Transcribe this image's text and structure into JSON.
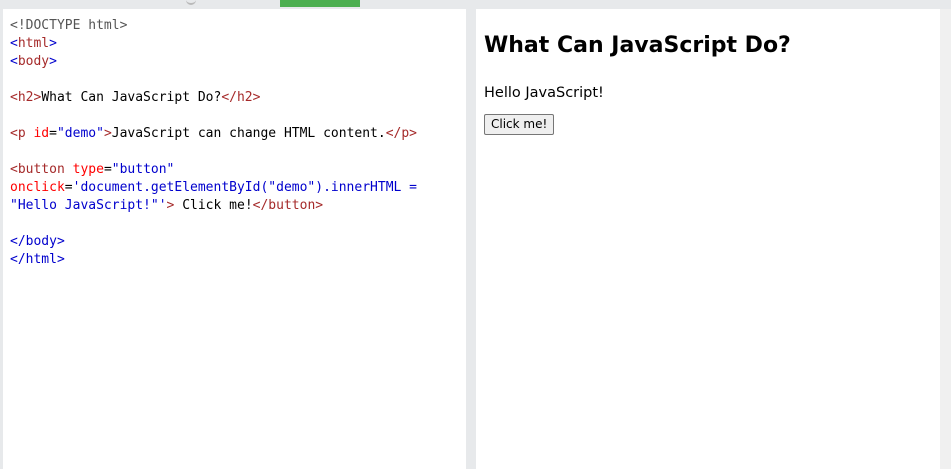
{
  "editor": {
    "lines": [
      {
        "doctype": "<!DOCTYPE html>"
      },
      {
        "open": "<",
        "tag": "html",
        "close": ">"
      },
      {
        "open": "<",
        "tag": "body",
        "close": ">"
      },
      {},
      {
        "h2_open": "<h2>",
        "h2_text": "What Can JavaScript Do?",
        "h2_close": "</h2>"
      },
      {},
      {
        "p_open_lt": "<p",
        "p_attr": " id",
        "p_eq": "=",
        "p_val": "\"demo\"",
        "p_gt": ">",
        "p_text": "JavaScript can change HTML content.",
        "p_close": "</p>"
      },
      {},
      {
        "btn_lt": "<button",
        "btn_attr": " type",
        "btn_eq": "=",
        "btn_val": "\"button\""
      },
      {
        "onclick_attr": "onclick",
        "onclick_eq": "=",
        "onclick_js": "'document.getElementById(\"demo\").innerHTML ="
      },
      {
        "js_cont": "\"Hello JavaScript!\"'",
        "btn_gt": ">",
        "btn_text": " Click me!",
        "btn_close": "</button>"
      },
      {},
      {
        "body_close": "</body>"
      },
      {
        "html_close": "</html>"
      }
    ]
  },
  "result": {
    "heading": "What Can JavaScript Do?",
    "paragraph": "Hello JavaScript!",
    "button_label": "Click me!"
  },
  "colors": {
    "run_tab": "#4caf50",
    "tag": "#a52a2a",
    "attribute": "#ff0000",
    "value": "#0000cd",
    "bracket": "#0000cd"
  }
}
